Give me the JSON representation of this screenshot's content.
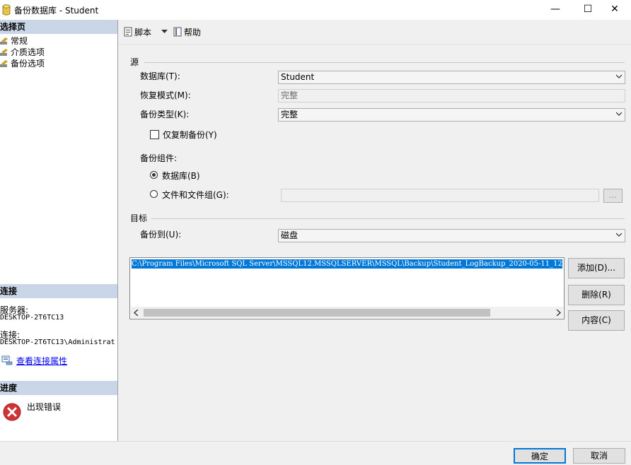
{
  "window": {
    "title": "备份数据库 - Student",
    "minimize_glyph": "—",
    "maximize_glyph": "☐",
    "close_glyph": "✕"
  },
  "left": {
    "select_page_header": "选择页",
    "pages": [
      {
        "label": "常规",
        "icon": "wrench-icon"
      },
      {
        "label": "介质选项",
        "icon": "wrench-icon"
      },
      {
        "label": "备份选项",
        "icon": "wrench-icon"
      }
    ],
    "connection_header": "连接",
    "server_label": "服务器:",
    "server_value": "DESKTOP-2T6TC13",
    "connection_label": "连接:",
    "connection_value": "DESKTOP-2T6TC13\\Administrat",
    "view_connection_link": "查看连接属性",
    "progress_header": "进度",
    "progress_status": "出现错误"
  },
  "toolbar": {
    "script_label": "脚本",
    "help_label": "帮助"
  },
  "source": {
    "group_label": "源",
    "database_label": "数据库(T):",
    "database_value": "Student",
    "recovery_label": "恢复模式(M):",
    "recovery_value": "完整",
    "backup_type_label": "备份类型(K):",
    "backup_type_value": "完整",
    "copy_only_label": "仅复制备份(Y)",
    "component_label": "备份组件:",
    "radio_database_label": "数据库(B)",
    "radio_files_label": "文件和文件组(G):",
    "files_browse_label": "..."
  },
  "destination": {
    "group_label": "目标",
    "backup_to_label": "备份到(U):",
    "backup_to_value": "磁盘",
    "path": "C:\\Program Files\\Microsoft SQL Server\\MSSQL12.MSSQLSERVER\\MSSQL\\Backup\\Student_LogBackup_2020-05-11_12",
    "add_label": "添加(D)...",
    "remove_label": "删除(R)",
    "contents_label": "内容(C)"
  },
  "footer": {
    "ok_label": "确定",
    "cancel_label": "取消"
  },
  "colors": {
    "section_header": "#c9d6e8",
    "selection": "#0078d7",
    "link": "#0000ee",
    "error": "#d13438"
  }
}
